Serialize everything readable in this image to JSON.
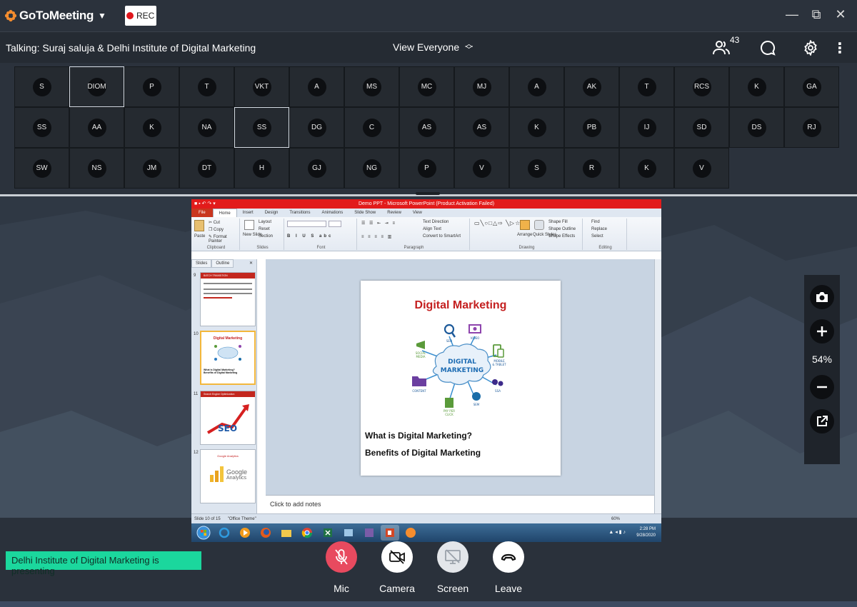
{
  "app": {
    "name": "GoToMeeting",
    "rec_label": "REC"
  },
  "infobar": {
    "talking": "Talking: Suraj saluja & Delhi Institute of Digital Marketing",
    "view_label": "View Everyone",
    "attendee_count": "43"
  },
  "attendees": [
    "S",
    "DIOM",
    "P",
    "T",
    "VKT",
    "A",
    "MS",
    "MC",
    "MJ",
    "A",
    "AK",
    "T",
    "RCS",
    "K",
    "GA",
    "SS",
    "AA",
    "K",
    "NA",
    "SS",
    "DG",
    "C",
    "AS",
    "AS",
    "K",
    "PB",
    "IJ",
    "SD",
    "DS",
    "RJ",
    "SW",
    "NS",
    "JM",
    "DT",
    "H",
    "GJ",
    "NG",
    "P",
    "V",
    "S",
    "R",
    "K",
    "V"
  ],
  "highlighted_attendees": [
    1,
    19
  ],
  "ppt": {
    "window_title": "Demo PPT - Microsoft PowerPoint (Product Activation Failed)",
    "tabs": [
      "File",
      "Home",
      "Insert",
      "Design",
      "Transitions",
      "Animations",
      "Slide Show",
      "Review",
      "View"
    ],
    "selected_tab": "Home",
    "ribbon": {
      "clipboard": {
        "name": "Clipboard",
        "paste": "Paste",
        "cut": "Cut",
        "copy": "Copy",
        "format_painter": "Format Painter"
      },
      "slides": {
        "name": "Slides",
        "new_slide": "New Slide",
        "layout": "Layout",
        "reset": "Reset",
        "section": "Section"
      },
      "font": {
        "name": "Font"
      },
      "paragraph": {
        "name": "Paragraph",
        "text_direction": "Text Direction",
        "align_text": "Align Text",
        "convert": "Convert to SmartArt"
      },
      "drawing": {
        "name": "Drawing",
        "arrange": "Arrange",
        "quick_styles": "Quick Styles",
        "shape_fill": "Shape Fill",
        "shape_outline": "Shape Outline",
        "shape_effects": "Shape Effects"
      },
      "editing": {
        "name": "Editing",
        "find": "Find",
        "replace": "Replace",
        "select": "Select"
      }
    },
    "panel_tabs": [
      "Slides",
      "Outline"
    ],
    "thumbnails": [
      {
        "num": "9",
        "title": "BATCH TRANSITION"
      },
      {
        "num": "10",
        "title": "Digital Marketing",
        "line1": "What is Digital Marketing?",
        "line2": "Benefits of Digital Marketing"
      },
      {
        "num": "11",
        "title": "Search Engine Optimization",
        "art": "SEO"
      },
      {
        "num": "12",
        "title": "Google Analytics",
        "art1": "Google",
        "art2": "Analytics"
      }
    ],
    "slide": {
      "title": "Digital Marketing",
      "center1": "DIGITAL",
      "center2": "MARKETING",
      "labels": {
        "seo": "SEO",
        "video": "VIDEO",
        "social1": "SOCIAL",
        "social2": "MEDIA",
        "mobile1": "MOBILE",
        "mobile2": "& TABLET",
        "content": "CONTENT",
        "ssa": "SSA",
        "sem": "SEM",
        "ppc1": "PAY PER",
        "ppc2": "CLICK"
      },
      "bullet1": "What is Digital Marketing?",
      "bullet2": "Benefits of Digital Marketing"
    },
    "notes_placeholder": "Click to add notes",
    "status_slide": "Slide 10 of 15",
    "status_theme": "\"Office Theme\"",
    "zoom": "60%",
    "clock_time": "2:28 PM",
    "clock_date": "9/28/2020"
  },
  "sidetools": {
    "zoom": "54%"
  },
  "presenting": "Delhi Institute of Digital Marketing is presenting",
  "controls": {
    "mic": "Mic",
    "camera": "Camera",
    "screen": "Screen",
    "leave": "Leave"
  },
  "colors": {
    "mic_muted": "#e84a5f",
    "accent_green": "#1bd79d",
    "rec_red": "#e0161c",
    "ppt_red": "#e21b1b"
  }
}
